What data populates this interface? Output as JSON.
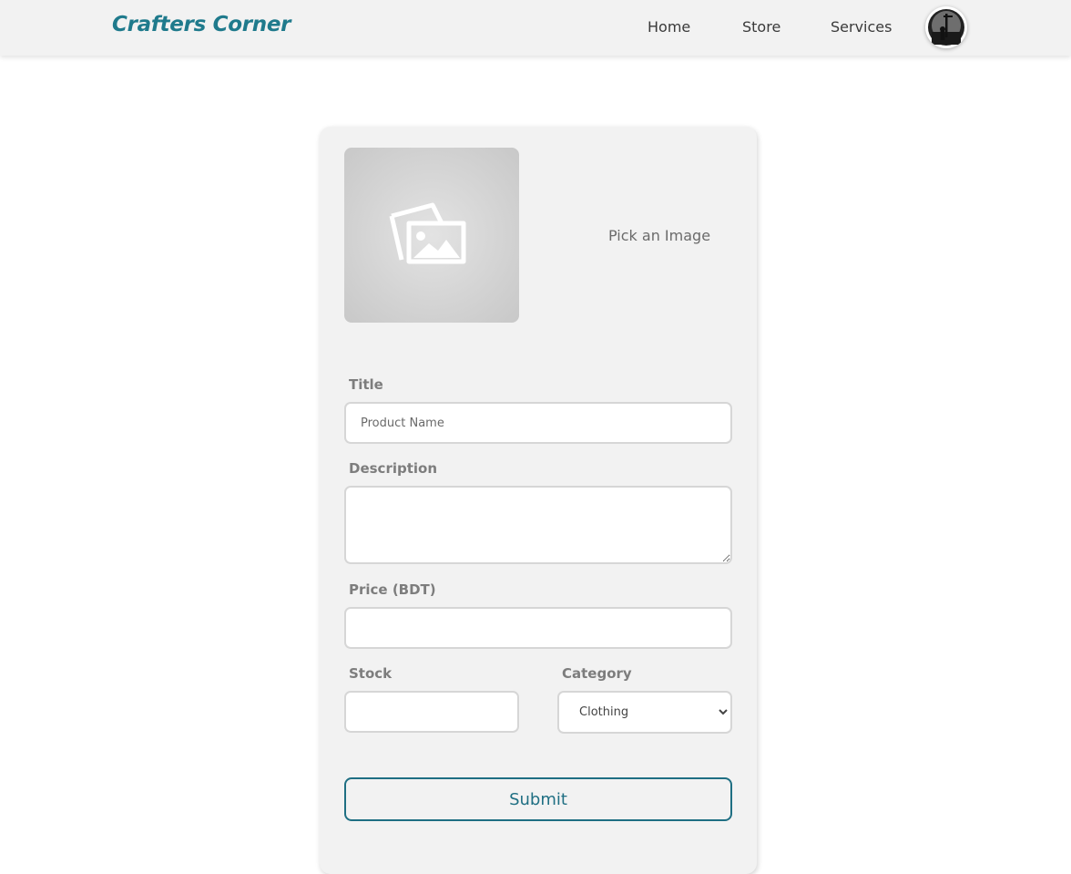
{
  "navbar": {
    "brand": "Crafters Corner",
    "links": [
      "Home",
      "Store",
      "Services"
    ],
    "avatar_icon": "user-avatar"
  },
  "form": {
    "image_picker": {
      "preview_icon": "image-placeholder-icon",
      "pick_label": "Pick an Image"
    },
    "title": {
      "label": "Title",
      "placeholder": "Product Name",
      "value": ""
    },
    "description": {
      "label": "Description",
      "value": ""
    },
    "price": {
      "label": "Price (BDT)",
      "value": ""
    },
    "stock": {
      "label": "Stock",
      "value": ""
    },
    "category": {
      "label": "Category",
      "selected": "Clothing"
    },
    "submit_label": "Submit"
  },
  "colors": {
    "brand": "#1f7a8c",
    "submit_border": "#1f6f83",
    "card_bg": "#f2f2f2"
  }
}
